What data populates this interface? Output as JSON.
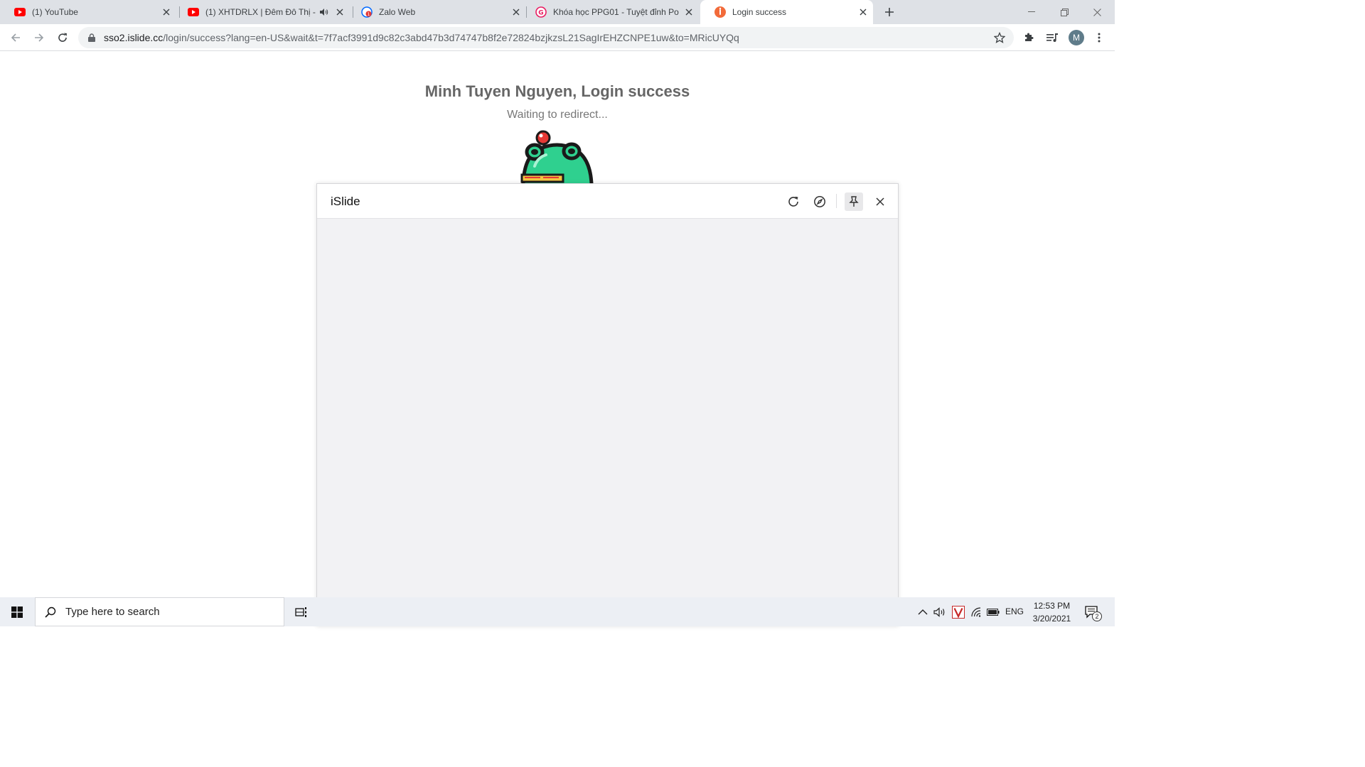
{
  "browser": {
    "tabs": [
      {
        "title": "(1) YouTube",
        "icon": "youtube-icon"
      },
      {
        "title": "(1) XHTDRLX | Đêm Đô Thị - (",
        "icon": "youtube-icon",
        "audio": true
      },
      {
        "title": "Zalo Web",
        "icon": "zalo-icon"
      },
      {
        "title": "Khóa học PPG01 - Tuyệt đỉnh Po",
        "icon": "ppg-icon"
      },
      {
        "title": "Login success",
        "icon": "islide-icon",
        "active": true
      }
    ],
    "url_host": "sso2.islide.cc",
    "url_path": "/login/success?lang=en-US&wait&t=7f7acf3991d9c82c3abd47b3d74747b8f2e72824bzjkzsL21SagIrEHZCNPE1uw&to=MRicUYQq",
    "profile_initial": "M"
  },
  "page": {
    "heading": "Minh Tuyen Nguyen, Login success",
    "subheading": "Waiting to redirect..."
  },
  "dialog": {
    "title": "iSlide"
  },
  "taskbar": {
    "search_placeholder": "Type here to search",
    "language": "ENG",
    "time": "12:53 PM",
    "date": "3/20/2021",
    "notification_count": "2"
  },
  "colors": {
    "youtube_red": "#ff0000",
    "islide_orange": "#f26b3a",
    "mascot_green": "#2fd08f"
  }
}
